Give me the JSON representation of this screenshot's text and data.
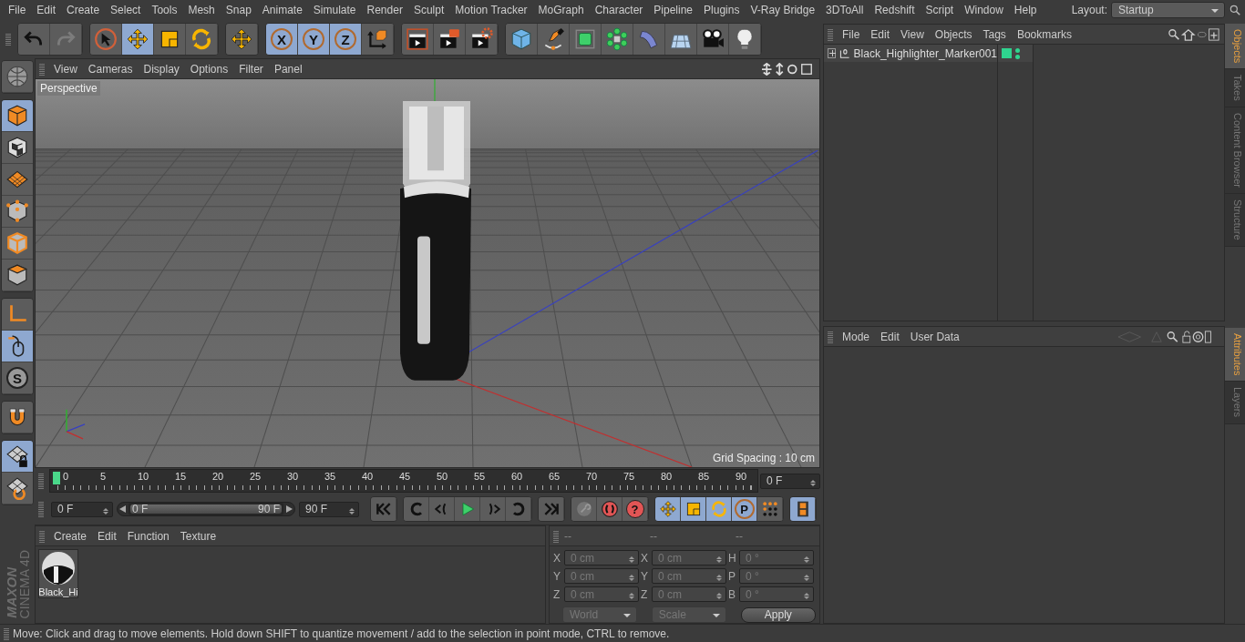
{
  "menu_bar": {
    "items": [
      "File",
      "Edit",
      "Create",
      "Select",
      "Tools",
      "Mesh",
      "Snap",
      "Animate",
      "Simulate",
      "Render",
      "Sculpt",
      "Motion Tracker",
      "MoGraph",
      "Character",
      "Pipeline",
      "Plugins",
      "V-Ray Bridge",
      "3DToAll",
      "Redshift",
      "Script",
      "Window",
      "Help"
    ],
    "layout_label": "Layout:",
    "layout_value": "Startup"
  },
  "toolbar": {
    "groups": [
      [
        {
          "kind": "undo",
          "selected": false
        },
        {
          "kind": "redo",
          "selected": false
        }
      ],
      [
        {
          "kind": "select",
          "selected": false
        },
        {
          "kind": "move",
          "selected": true
        },
        {
          "kind": "scale",
          "selected": false
        },
        {
          "kind": "rotate",
          "selected": false
        }
      ],
      [
        {
          "kind": "move",
          "selected": false
        }
      ],
      [
        {
          "kind": "axis-lock",
          "label": "X",
          "selected": true
        },
        {
          "kind": "axis-lock",
          "label": "Y",
          "selected": true
        },
        {
          "kind": "axis-lock",
          "label": "Z",
          "selected": true
        },
        {
          "kind": "coords",
          "selected": false
        }
      ],
      [
        {
          "kind": "render-view",
          "selected": false
        },
        {
          "kind": "render-viewer",
          "selected": false
        },
        {
          "kind": "render-settings",
          "selected": false
        }
      ],
      [
        {
          "kind": "cube",
          "selected": false
        },
        {
          "kind": "pen",
          "selected": false
        },
        {
          "kind": "subdiv",
          "selected": false
        },
        {
          "kind": "cloner",
          "selected": false
        },
        {
          "kind": "bend",
          "selected": false
        },
        {
          "kind": "floor",
          "selected": false
        },
        {
          "kind": "camera",
          "selected": false
        },
        {
          "kind": "light",
          "selected": false
        }
      ]
    ]
  },
  "left_toolbar": {
    "groups": [
      [
        {
          "kind": "editable",
          "selected": false
        }
      ],
      [
        {
          "kind": "model",
          "selected": true
        },
        {
          "kind": "texture",
          "selected": false
        },
        {
          "kind": "workplane",
          "selected": false
        },
        {
          "kind": "points",
          "selected": false
        },
        {
          "kind": "edges",
          "selected": false
        },
        {
          "kind": "polygons",
          "selected": false
        }
      ],
      [
        {
          "kind": "axis",
          "selected": false
        },
        {
          "kind": "tweak",
          "selected": true
        },
        {
          "kind": "solo",
          "label": "S",
          "selected": false
        }
      ],
      [
        {
          "kind": "magnet",
          "selected": false
        }
      ],
      [
        {
          "kind": "plane-lock",
          "selected": true
        },
        {
          "kind": "plane-align",
          "selected": false
        }
      ]
    ]
  },
  "logo": {
    "brand": "MAXON",
    "product": "CINEMA 4D"
  },
  "viewport": {
    "menu": [
      "View",
      "Cameras",
      "Display",
      "Options",
      "Filter",
      "Panel"
    ],
    "camera_label": "Perspective",
    "grid_spacing": "Grid Spacing : 10 cm"
  },
  "timeline": {
    "ticks": [
      "0",
      "5",
      "10",
      "15",
      "20",
      "25",
      "30",
      "35",
      "40",
      "45",
      "50",
      "55",
      "60",
      "65",
      "70",
      "75",
      "80",
      "85",
      "90"
    ],
    "current_frame": "0 F"
  },
  "playback": {
    "start_field": "0 F",
    "range": {
      "start": "0 F",
      "end": "90 F",
      "level": 1
    },
    "end_field": "90 F",
    "groups": [
      [
        {
          "kind": "go-start",
          "selected": false
        }
      ],
      [
        {
          "kind": "prev-key",
          "selected": false
        },
        {
          "kind": "prev-frame",
          "selected": false
        },
        {
          "kind": "play",
          "selected": false
        },
        {
          "kind": "next-frame",
          "selected": false
        },
        {
          "kind": "next-key",
          "selected": false
        }
      ],
      [
        {
          "kind": "go-end",
          "selected": false
        }
      ],
      [
        {
          "kind": "keyframe",
          "selected": false
        },
        {
          "kind": "record",
          "selected": false
        },
        {
          "kind": "help",
          "label": "?",
          "selected": false
        }
      ],
      [
        {
          "kind": "move",
          "selected": true
        },
        {
          "kind": "scale",
          "selected": true
        },
        {
          "kind": "rotate",
          "selected": true
        },
        {
          "kind": "param",
          "label": "P",
          "selected": true
        },
        {
          "kind": "dots",
          "selected": false
        }
      ],
      [
        {
          "kind": "film",
          "selected": true
        }
      ]
    ]
  },
  "material_manager": {
    "menu": [
      "Create",
      "Edit",
      "Function",
      "Texture"
    ],
    "materials": [
      {
        "name": "Black_Hi"
      }
    ]
  },
  "coordinates": {
    "headers": [
      "--",
      "--",
      "--"
    ],
    "rows": [
      [
        {
          "axis": "X",
          "value": "0 cm"
        },
        {
          "axis": "X",
          "value": "0 cm"
        },
        {
          "axis": "H",
          "value": "0 °"
        }
      ],
      [
        {
          "axis": "Y",
          "value": "0 cm"
        },
        {
          "axis": "Y",
          "value": "0 cm"
        },
        {
          "axis": "P",
          "value": "0 °"
        }
      ],
      [
        {
          "axis": "Z",
          "value": "0 cm"
        },
        {
          "axis": "Z",
          "value": "0 cm"
        },
        {
          "axis": "B",
          "value": "0 °"
        }
      ]
    ],
    "mode_dropdown": "World",
    "size_dropdown": "Scale",
    "apply": "Apply"
  },
  "object_manager": {
    "menu": [
      "File",
      "Edit",
      "View",
      "Objects",
      "Tags",
      "Bookmarks"
    ],
    "objects": [
      {
        "name": "Black_Highlighter_Marker001",
        "expanded": false,
        "color": "#2fd48f"
      }
    ]
  },
  "attribute_manager": {
    "menu": [
      "Mode",
      "Edit",
      "User Data"
    ]
  },
  "side_tabs_top": [
    {
      "label": "Objects",
      "selected": true
    },
    {
      "label": "Takes",
      "selected": false
    },
    {
      "label": "Content Browser",
      "selected": false
    },
    {
      "label": "Structure",
      "selected": false
    }
  ],
  "side_tabs_bottom": [
    {
      "label": "Attributes",
      "selected": true
    },
    {
      "label": "Layers",
      "selected": false
    }
  ],
  "status_bar": "Move: Click and drag to move elements. Hold down SHIFT to quantize movement / add to the selection in point mode, CTRL to remove."
}
